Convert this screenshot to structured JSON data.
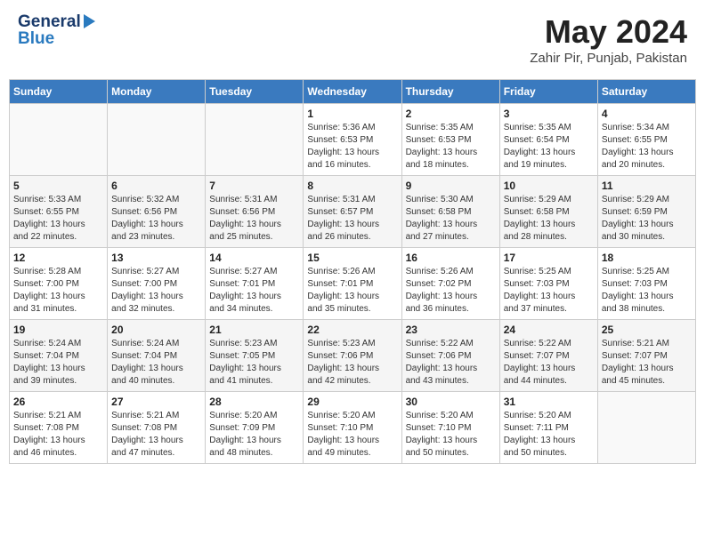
{
  "header": {
    "logo_general": "General",
    "logo_blue": "Blue",
    "month_title": "May 2024",
    "location": "Zahir Pir, Punjab, Pakistan"
  },
  "days_of_week": [
    "Sunday",
    "Monday",
    "Tuesday",
    "Wednesday",
    "Thursday",
    "Friday",
    "Saturday"
  ],
  "weeks": [
    [
      {
        "day": "",
        "info": ""
      },
      {
        "day": "",
        "info": ""
      },
      {
        "day": "",
        "info": ""
      },
      {
        "day": "1",
        "info": "Sunrise: 5:36 AM\nSunset: 6:53 PM\nDaylight: 13 hours\nand 16 minutes."
      },
      {
        "day": "2",
        "info": "Sunrise: 5:35 AM\nSunset: 6:53 PM\nDaylight: 13 hours\nand 18 minutes."
      },
      {
        "day": "3",
        "info": "Sunrise: 5:35 AM\nSunset: 6:54 PM\nDaylight: 13 hours\nand 19 minutes."
      },
      {
        "day": "4",
        "info": "Sunrise: 5:34 AM\nSunset: 6:55 PM\nDaylight: 13 hours\nand 20 minutes."
      }
    ],
    [
      {
        "day": "5",
        "info": "Sunrise: 5:33 AM\nSunset: 6:55 PM\nDaylight: 13 hours\nand 22 minutes."
      },
      {
        "day": "6",
        "info": "Sunrise: 5:32 AM\nSunset: 6:56 PM\nDaylight: 13 hours\nand 23 minutes."
      },
      {
        "day": "7",
        "info": "Sunrise: 5:31 AM\nSunset: 6:56 PM\nDaylight: 13 hours\nand 25 minutes."
      },
      {
        "day": "8",
        "info": "Sunrise: 5:31 AM\nSunset: 6:57 PM\nDaylight: 13 hours\nand 26 minutes."
      },
      {
        "day": "9",
        "info": "Sunrise: 5:30 AM\nSunset: 6:58 PM\nDaylight: 13 hours\nand 27 minutes."
      },
      {
        "day": "10",
        "info": "Sunrise: 5:29 AM\nSunset: 6:58 PM\nDaylight: 13 hours\nand 28 minutes."
      },
      {
        "day": "11",
        "info": "Sunrise: 5:29 AM\nSunset: 6:59 PM\nDaylight: 13 hours\nand 30 minutes."
      }
    ],
    [
      {
        "day": "12",
        "info": "Sunrise: 5:28 AM\nSunset: 7:00 PM\nDaylight: 13 hours\nand 31 minutes."
      },
      {
        "day": "13",
        "info": "Sunrise: 5:27 AM\nSunset: 7:00 PM\nDaylight: 13 hours\nand 32 minutes."
      },
      {
        "day": "14",
        "info": "Sunrise: 5:27 AM\nSunset: 7:01 PM\nDaylight: 13 hours\nand 34 minutes."
      },
      {
        "day": "15",
        "info": "Sunrise: 5:26 AM\nSunset: 7:01 PM\nDaylight: 13 hours\nand 35 minutes."
      },
      {
        "day": "16",
        "info": "Sunrise: 5:26 AM\nSunset: 7:02 PM\nDaylight: 13 hours\nand 36 minutes."
      },
      {
        "day": "17",
        "info": "Sunrise: 5:25 AM\nSunset: 7:03 PM\nDaylight: 13 hours\nand 37 minutes."
      },
      {
        "day": "18",
        "info": "Sunrise: 5:25 AM\nSunset: 7:03 PM\nDaylight: 13 hours\nand 38 minutes."
      }
    ],
    [
      {
        "day": "19",
        "info": "Sunrise: 5:24 AM\nSunset: 7:04 PM\nDaylight: 13 hours\nand 39 minutes."
      },
      {
        "day": "20",
        "info": "Sunrise: 5:24 AM\nSunset: 7:04 PM\nDaylight: 13 hours\nand 40 minutes."
      },
      {
        "day": "21",
        "info": "Sunrise: 5:23 AM\nSunset: 7:05 PM\nDaylight: 13 hours\nand 41 minutes."
      },
      {
        "day": "22",
        "info": "Sunrise: 5:23 AM\nSunset: 7:06 PM\nDaylight: 13 hours\nand 42 minutes."
      },
      {
        "day": "23",
        "info": "Sunrise: 5:22 AM\nSunset: 7:06 PM\nDaylight: 13 hours\nand 43 minutes."
      },
      {
        "day": "24",
        "info": "Sunrise: 5:22 AM\nSunset: 7:07 PM\nDaylight: 13 hours\nand 44 minutes."
      },
      {
        "day": "25",
        "info": "Sunrise: 5:21 AM\nSunset: 7:07 PM\nDaylight: 13 hours\nand 45 minutes."
      }
    ],
    [
      {
        "day": "26",
        "info": "Sunrise: 5:21 AM\nSunset: 7:08 PM\nDaylight: 13 hours\nand 46 minutes."
      },
      {
        "day": "27",
        "info": "Sunrise: 5:21 AM\nSunset: 7:08 PM\nDaylight: 13 hours\nand 47 minutes."
      },
      {
        "day": "28",
        "info": "Sunrise: 5:20 AM\nSunset: 7:09 PM\nDaylight: 13 hours\nand 48 minutes."
      },
      {
        "day": "29",
        "info": "Sunrise: 5:20 AM\nSunset: 7:10 PM\nDaylight: 13 hours\nand 49 minutes."
      },
      {
        "day": "30",
        "info": "Sunrise: 5:20 AM\nSunset: 7:10 PM\nDaylight: 13 hours\nand 50 minutes."
      },
      {
        "day": "31",
        "info": "Sunrise: 5:20 AM\nSunset: 7:11 PM\nDaylight: 13 hours\nand 50 minutes."
      },
      {
        "day": "",
        "info": ""
      }
    ]
  ]
}
